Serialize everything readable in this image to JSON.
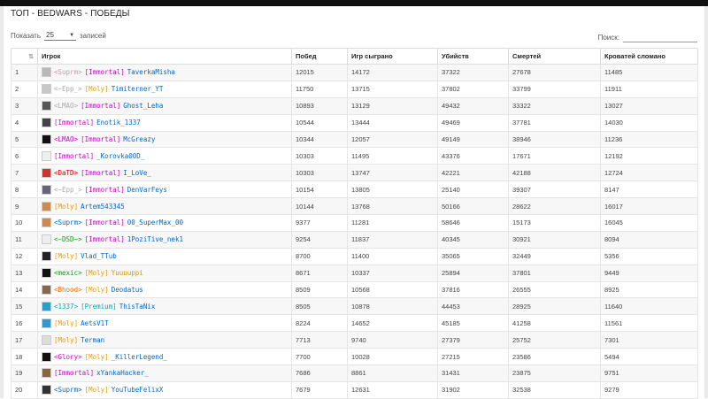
{
  "title": "ТОП - BEDWARS - ПОБЕДЫ",
  "length": {
    "label_before": "Показать",
    "value": "25",
    "label_after": "записей"
  },
  "search": {
    "label": "Поиск:"
  },
  "columns": [
    "",
    "Игрок",
    "Побед",
    "Игр сыграно",
    "Убийств",
    "Смертей",
    "Кроватей сломано"
  ],
  "rows": [
    {
      "n": "1",
      "tags": [
        {
          "t": "<Suprm>",
          "c": "#c9a"
        },
        {
          "t": "[Immortal]",
          "c": "#c0c"
        }
      ],
      "name": "TaverkaMisha",
      "nc": "#06c",
      "av": "#b8b8b8",
      "v": [
        "12015",
        "14172",
        "37322",
        "27678",
        "11485"
      ]
    },
    {
      "n": "2",
      "tags": [
        {
          "t": "<~Epp_>",
          "c": "#aaa"
        },
        {
          "t": "[Moly]",
          "c": "#e90"
        }
      ],
      "name": "Timiterner_YT",
      "nc": "#06c",
      "av": "#c8c8c8",
      "v": [
        "11750",
        "13715",
        "37802",
        "33799",
        "11911"
      ]
    },
    {
      "n": "3",
      "tags": [
        {
          "t": "<LMAO>",
          "c": "#aaa"
        },
        {
          "t": "[Immortal]",
          "c": "#c0c"
        }
      ],
      "name": "Ghost_Leha",
      "nc": "#06c",
      "av": "#555",
      "v": [
        "10893",
        "13129",
        "49432",
        "33322",
        "13027"
      ]
    },
    {
      "n": "4",
      "tags": [
        {
          "t": "[Immortal]",
          "c": "#c0c"
        }
      ],
      "name": "Enotik_1337",
      "nc": "#06c",
      "av": "#444",
      "v": [
        "10544",
        "13444",
        "49469",
        "37781",
        "14030"
      ]
    },
    {
      "n": "5",
      "tags": [
        {
          "t": "<LMAO>",
          "c": "#c0c"
        },
        {
          "t": "[Immortal]",
          "c": "#c0c"
        }
      ],
      "name": "McGreazy",
      "nc": "#06c",
      "av": "#111",
      "v": [
        "10344",
        "12057",
        "49149",
        "38946",
        "11236"
      ]
    },
    {
      "n": "6",
      "tags": [
        {
          "t": "[Immortal]",
          "c": "#c0c"
        }
      ],
      "name": "_Korovka00D_",
      "nc": "#06c",
      "av": "#f0f0f0",
      "v": [
        "10303",
        "11495",
        "43376",
        "17671",
        "12192"
      ]
    },
    {
      "n": "7",
      "tags": [
        {
          "t": "<DaTD>",
          "c": "#c00"
        },
        {
          "t": "[Immortal]",
          "c": "#c0c"
        }
      ],
      "name": "I_LoVe_",
      "nc": "#06c",
      "av": "#c33",
      "v": [
        "10303",
        "13747",
        "42221",
        "42188",
        "12724"
      ]
    },
    {
      "n": "8",
      "tags": [
        {
          "t": "<~Epp_>",
          "c": "#aaa"
        },
        {
          "t": "[Immortal]",
          "c": "#c0c"
        }
      ],
      "name": "DenVarFeys",
      "nc": "#06c",
      "av": "#667",
      "v": [
        "10154",
        "13805",
        "25140",
        "39307",
        "8147"
      ]
    },
    {
      "n": "9",
      "tags": [
        {
          "t": "[Moly]",
          "c": "#e90"
        }
      ],
      "name": "Artem543345",
      "nc": "#06c",
      "av": "#c85",
      "v": [
        "10144",
        "13768",
        "50166",
        "28622",
        "16017"
      ]
    },
    {
      "n": "10",
      "tags": [
        {
          "t": "<Suprm>",
          "c": "#06c"
        },
        {
          "t": "[Immortal]",
          "c": "#c0c"
        }
      ],
      "name": "00_SuperMax_00",
      "nc": "#06c",
      "av": "#c85",
      "v": [
        "9377",
        "11281",
        "58646",
        "15173",
        "16045"
      ]
    },
    {
      "n": "11",
      "tags": [
        {
          "t": "<~DSD~>",
          "c": "#0a0"
        },
        {
          "t": "[Immortal]",
          "c": "#c0c"
        }
      ],
      "name": "1PoziTive_nek1",
      "nc": "#06c",
      "av": "#eee",
      "v": [
        "9254",
        "11837",
        "40345",
        "30921",
        "8094"
      ]
    },
    {
      "n": "12",
      "tags": [
        {
          "t": "[Moly]",
          "c": "#e90"
        }
      ],
      "name": "Vlad_TTub",
      "nc": "#06c",
      "av": "#222",
      "v": [
        "8700",
        "11400",
        "35065",
        "32449",
        "5356"
      ]
    },
    {
      "n": "13",
      "tags": [
        {
          "t": "<mexic>",
          "c": "#0a0"
        },
        {
          "t": "[Moly]",
          "c": "#e90"
        }
      ],
      "name": "Yuuuuppi",
      "nc": "#c90",
      "av": "#111",
      "v": [
        "8671",
        "10337",
        "25894",
        "37801",
        "9449"
      ]
    },
    {
      "n": "14",
      "tags": [
        {
          "t": "<Bhood>",
          "c": "#e60"
        },
        {
          "t": "[Moly]",
          "c": "#e90"
        }
      ],
      "name": "Deodatus",
      "nc": "#06c",
      "av": "#865",
      "v": [
        "8509",
        "10568",
        "37816",
        "26555",
        "8925"
      ]
    },
    {
      "n": "15",
      "tags": [
        {
          "t": "<1337>",
          "c": "#0aa"
        },
        {
          "t": "[Premium]",
          "c": "#0aa"
        }
      ],
      "name": "ThisTaNix",
      "nc": "#06c",
      "av": "#39c",
      "v": [
        "8505",
        "10878",
        "44453",
        "28925",
        "11640"
      ]
    },
    {
      "n": "16",
      "tags": [
        {
          "t": "[Moly]",
          "c": "#e90"
        }
      ],
      "name": "AetsV1T",
      "nc": "#06c",
      "av": "#39c",
      "v": [
        "8224",
        "14652",
        "45185",
        "41258",
        "11561"
      ]
    },
    {
      "n": "17",
      "tags": [
        {
          "t": "[Moly]",
          "c": "#e90"
        }
      ],
      "name": "Terman",
      "nc": "#06c",
      "av": "#ddd",
      "v": [
        "7713",
        "9740",
        "27379",
        "25752",
        "7301"
      ]
    },
    {
      "n": "18",
      "tags": [
        {
          "t": "<Glory>",
          "c": "#c0c"
        },
        {
          "t": "[Moly]",
          "c": "#e90"
        }
      ],
      "name": "_KillerLegend_",
      "nc": "#06c",
      "av": "#111",
      "v": [
        "7700",
        "10028",
        "27215",
        "23586",
        "5494"
      ]
    },
    {
      "n": "19",
      "tags": [
        {
          "t": "[Immortal]",
          "c": "#c0c"
        }
      ],
      "name": "xYankaHacker_",
      "nc": "#06c",
      "av": "#864",
      "v": [
        "7686",
        "8861",
        "31431",
        "23875",
        "9751"
      ]
    },
    {
      "n": "20",
      "tags": [
        {
          "t": "<Suprm>",
          "c": "#06c"
        },
        {
          "t": "[Moly]",
          "c": "#e90"
        }
      ],
      "name": "YouTubeFelixX",
      "nc": "#06c",
      "av": "#333",
      "v": [
        "7679",
        "12631",
        "31902",
        "32538",
        "9279"
      ]
    }
  ]
}
